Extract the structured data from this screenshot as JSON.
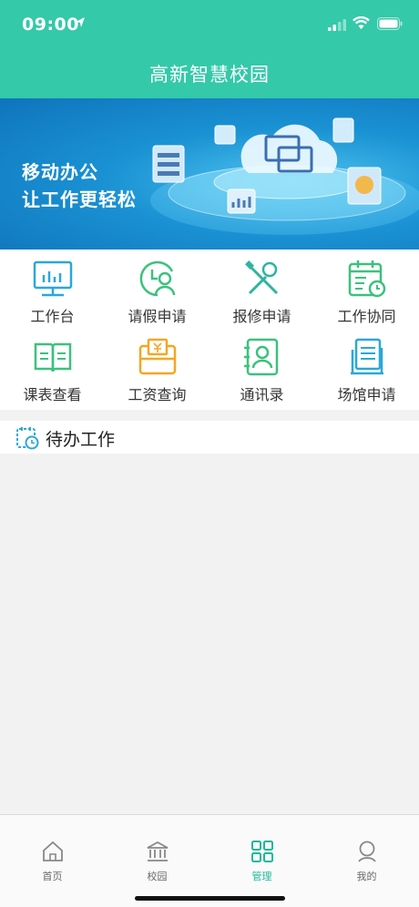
{
  "status": {
    "time": "09:00"
  },
  "header": {
    "title": "高新智慧校园"
  },
  "banner": {
    "line1": "移动办公",
    "line2": "让工作更轻松"
  },
  "menu": {
    "items": [
      {
        "label": "工作台",
        "icon": "dashboard-monitor-icon"
      },
      {
        "label": "请假申请",
        "icon": "leave-request-icon"
      },
      {
        "label": "报修申请",
        "icon": "repair-tools-icon"
      },
      {
        "label": "工作协同",
        "icon": "calendar-collab-icon"
      },
      {
        "label": "课表查看",
        "icon": "open-book-icon"
      },
      {
        "label": "工资查询",
        "icon": "salary-envelope-icon"
      },
      {
        "label": "通讯录",
        "icon": "contacts-icon"
      },
      {
        "label": "场馆申请",
        "icon": "venue-document-icon"
      }
    ]
  },
  "pending": {
    "title": "待办工作"
  },
  "tabbar": {
    "tabs": [
      {
        "label": "首页",
        "icon": "home-icon"
      },
      {
        "label": "校园",
        "icon": "campus-building-icon"
      },
      {
        "label": "管理",
        "icon": "grid-manage-icon"
      },
      {
        "label": "我的",
        "icon": "user-icon"
      }
    ],
    "active_index": 2
  },
  "colors": {
    "header_bg": "#34c9a9",
    "accent": "#1fb79a",
    "icon_cyan": "#2aa8d8",
    "icon_green": "#3cc17e",
    "icon_orange": "#f5a623"
  }
}
